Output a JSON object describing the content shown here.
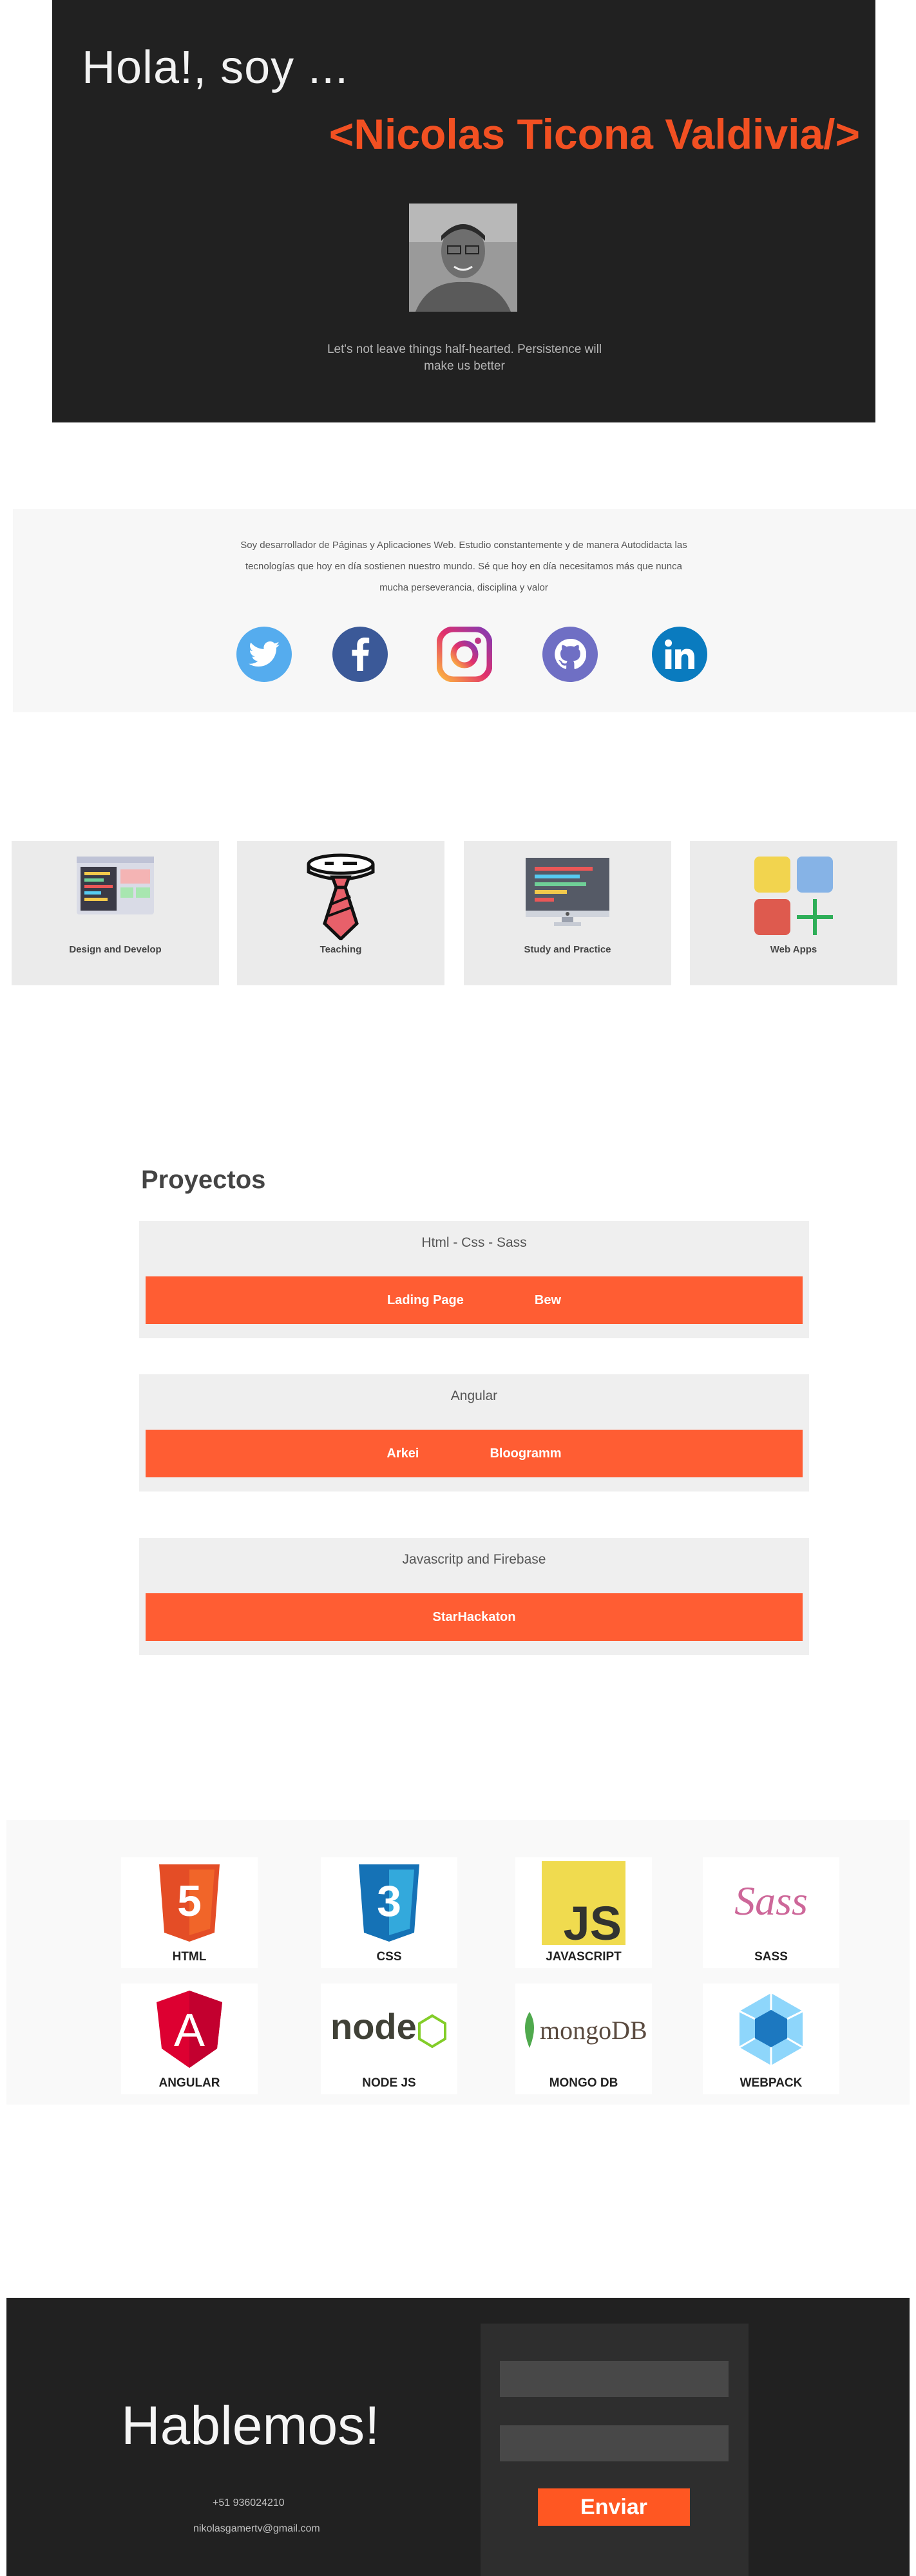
{
  "hero": {
    "greeting": "Hola!, soy ...",
    "name": "<Nicolas Ticona Valdivia/>",
    "quote": "Let's not leave things half-hearted. Persistence will make us better"
  },
  "about": {
    "text": "Soy desarrollador de Páginas y Aplicaciones Web. Estudio constantemente y de manera Autodidacta las tecnologías que hoy en día sostienen nuestro mundo. Sé que hoy en día necesitamos más que nunca mucha perseverancia, disciplina y valor",
    "social": [
      "twitter-icon",
      "facebook-icon",
      "instagram-icon",
      "github-icon",
      "linkedin-icon"
    ]
  },
  "services": [
    {
      "label": "Design and Develop"
    },
    {
      "label": "Teaching"
    },
    {
      "label": "Study and Practice"
    },
    {
      "label": "Web Apps"
    }
  ],
  "projects": {
    "title": "Proyectos",
    "groups": [
      {
        "title": "Html - Css - Sass",
        "links": [
          "Lading Page",
          "Bew"
        ]
      },
      {
        "title": "Angular",
        "links": [
          "Arkei",
          "Bloogramm"
        ]
      },
      {
        "title": "Javascritp and Firebase",
        "links": [
          "StarHackaton"
        ]
      }
    ]
  },
  "tech": [
    {
      "label": "HTML",
      "logo": "html5-logo",
      "logo_text": "5"
    },
    {
      "label": "CSS",
      "logo": "css3-logo",
      "logo_text": "3"
    },
    {
      "label": "JAVASCRIPT",
      "logo": "js-logo",
      "logo_text": "JS"
    },
    {
      "label": "SASS",
      "logo": "sass-logo",
      "logo_text": "Sass"
    },
    {
      "label": "ANGULAR",
      "logo": "angular-logo",
      "logo_text": "A"
    },
    {
      "label": "NODE JS",
      "logo": "nodejs-logo",
      "logo_text": "node"
    },
    {
      "label": "MONGO DB",
      "logo": "mongodb-logo",
      "logo_text": "mongoDB"
    },
    {
      "label": "WEBPACK",
      "logo": "webpack-logo"
    }
  ],
  "contact": {
    "title": "Hablemos!",
    "phone": "+51 936024210",
    "email": "nikolasgamertv@gmail.com",
    "send_label": "Enviar"
  },
  "colors": {
    "accent": "#ff5d33",
    "dark": "#212121",
    "name": "#f25022"
  }
}
